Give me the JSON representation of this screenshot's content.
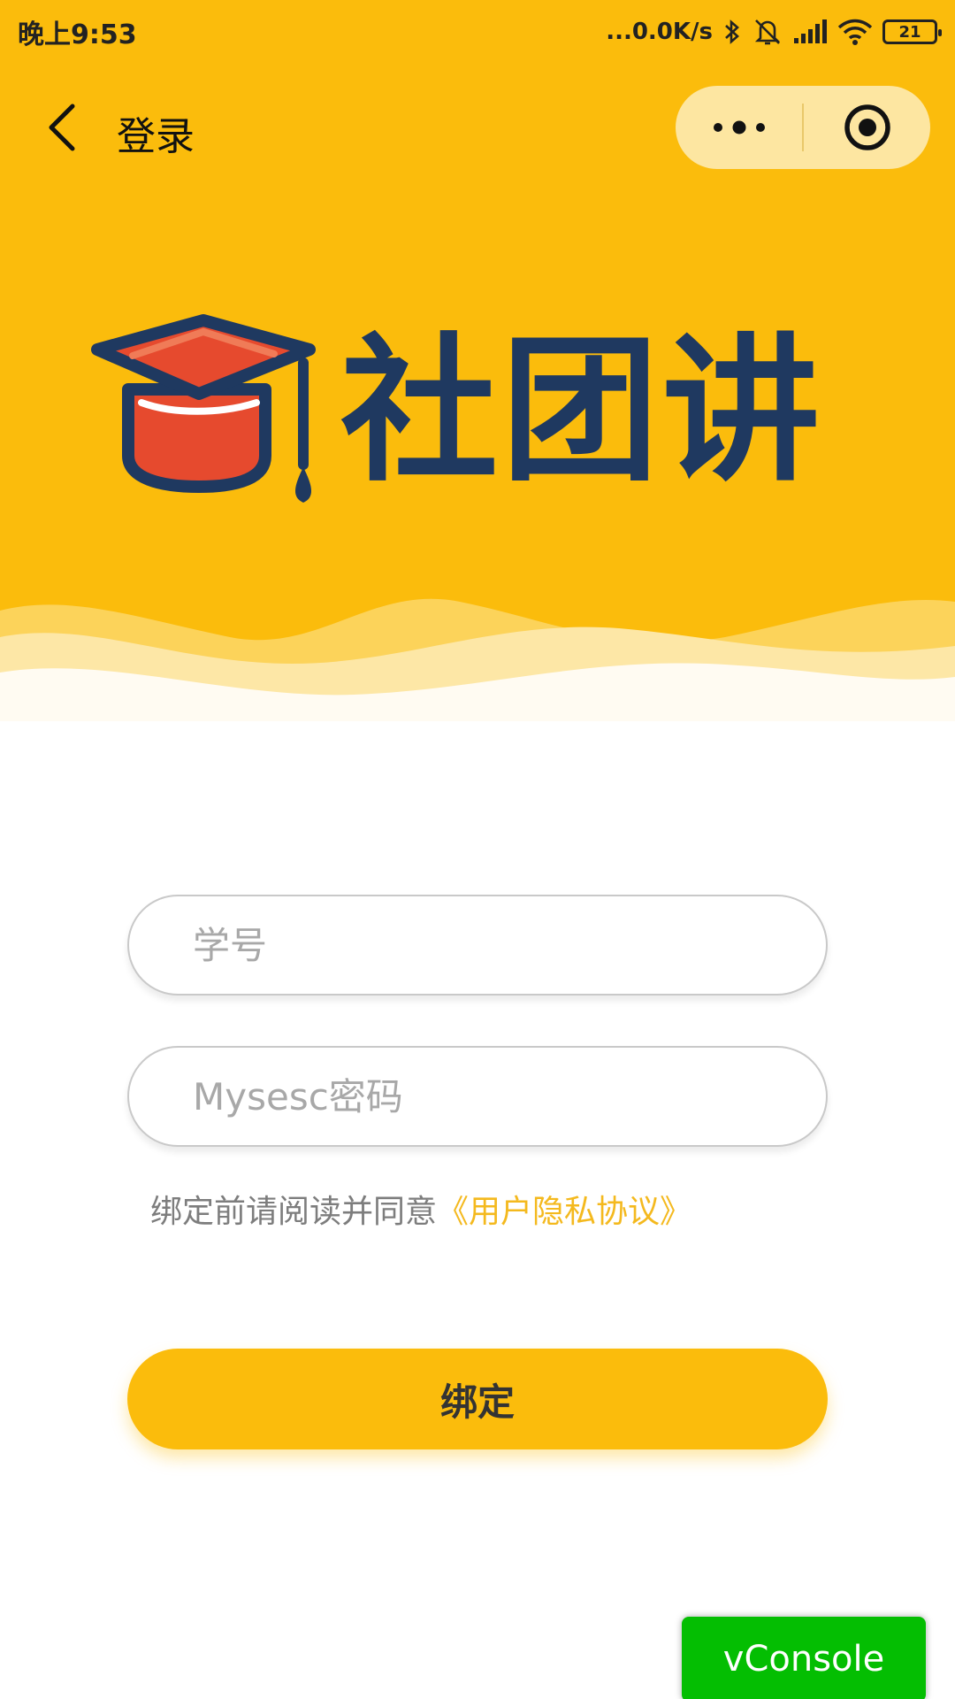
{
  "status_bar": {
    "time": "晚上9:53",
    "network_speed": "...0.0K/s",
    "battery": "21"
  },
  "nav": {
    "title": "登录",
    "back_icon": "chevron-left-icon",
    "more_icon": "more-dots-icon",
    "close_icon": "target-icon"
  },
  "logo": {
    "text": "社团讲",
    "icon": "graduation-cap-icon"
  },
  "form": {
    "student_id_placeholder": "学号",
    "password_placeholder": "Mysesc密码",
    "agreement_text": "绑定前请阅读并同意",
    "agreement_link": "《用户隐私协议》",
    "submit_label": "绑定"
  },
  "vconsole": {
    "label": "vConsole"
  },
  "colors": {
    "brand_yellow": "#FBBC0C",
    "logo_navy": "#1F3960",
    "cap_red": "#E64A2E",
    "link_yellow": "#F4B91E",
    "vconsole_green": "#04BE02"
  }
}
